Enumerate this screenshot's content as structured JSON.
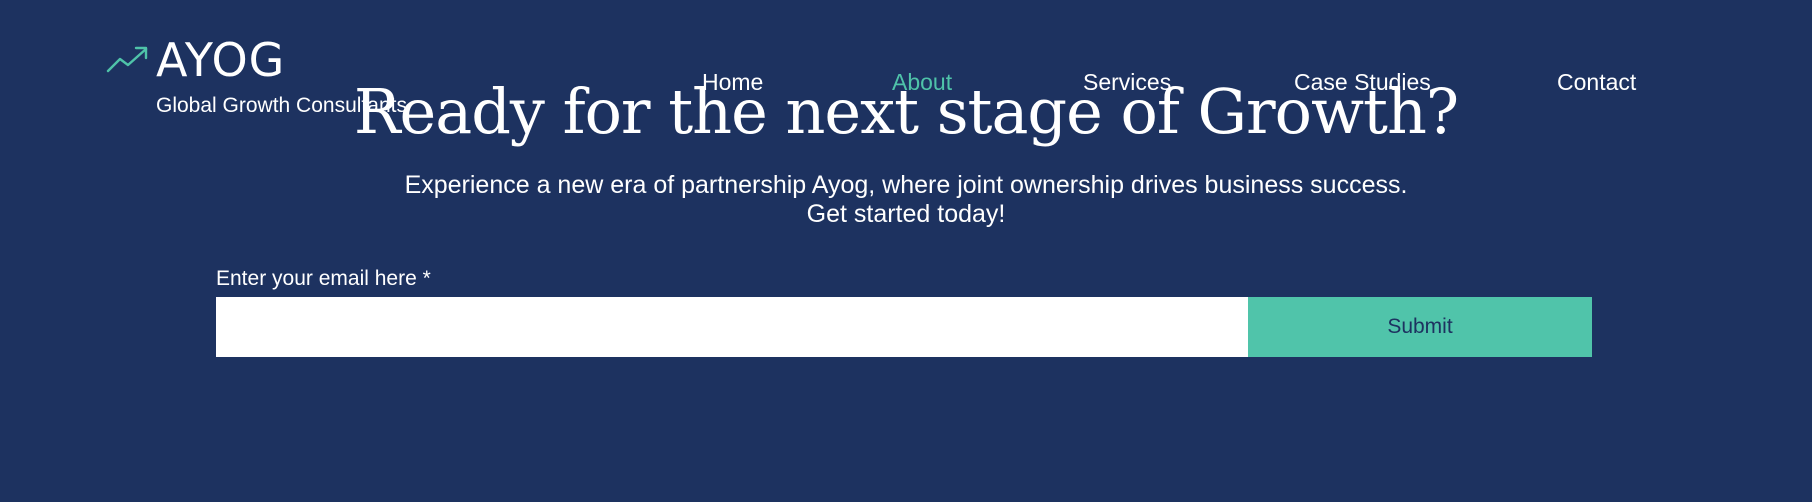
{
  "colors": {
    "background": "#1d3260",
    "accent": "#4fc3a9",
    "text": "#ffffff",
    "button_background": "#50c4aa",
    "button_text": "#1d3260"
  },
  "header": {
    "logo": {
      "icon": "trend-up-icon",
      "text": "AYOG",
      "tagline": "Global Growth Consultants"
    },
    "nav": {
      "active": "About",
      "items": [
        {
          "label": "Home"
        },
        {
          "label": "About"
        },
        {
          "label": "Services"
        },
        {
          "label": "Case Studies"
        },
        {
          "label": "Contact"
        }
      ]
    }
  },
  "hero": {
    "headline": "Ready for the next stage of Growth?",
    "subtext_line1": "Experience a new era of partnership Ayog, where joint ownership drives business success.",
    "subtext_line2": "Get started today!"
  },
  "form": {
    "email_label": "Enter your email here *",
    "email_value": "",
    "submit_label": "Submit"
  }
}
